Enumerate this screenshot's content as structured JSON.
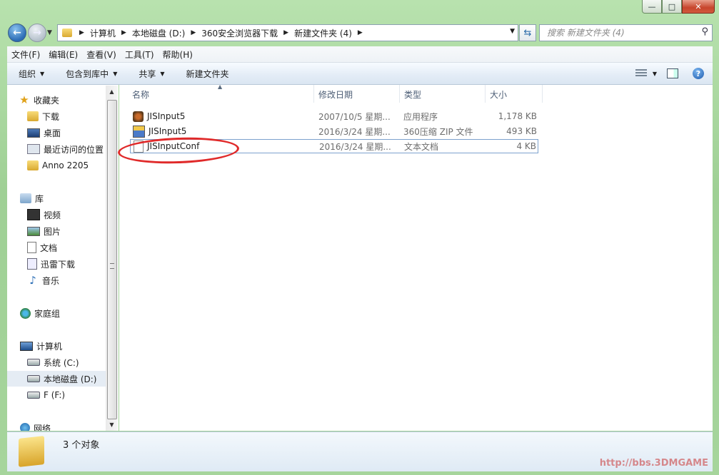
{
  "window": {
    "caption_buttons": [
      "—",
      "□",
      "✕"
    ]
  },
  "address": {
    "crumbs": [
      "计算机",
      "本地磁盘 (D:)",
      "360安全浏览器下载",
      "新建文件夹 (4)"
    ]
  },
  "search": {
    "placeholder": "搜索 新建文件夹 (4)"
  },
  "menu": [
    "文件(F)",
    "编辑(E)",
    "查看(V)",
    "工具(T)",
    "帮助(H)"
  ],
  "commands": [
    "组织",
    "包含到库中",
    "共享",
    "新建文件夹"
  ],
  "nav": {
    "favorites": {
      "label": "收藏夹",
      "items": [
        "下载",
        "桌面",
        "最近访问的位置",
        "Anno 2205"
      ]
    },
    "libraries": {
      "label": "库",
      "items": [
        "视频",
        "图片",
        "文档",
        "迅雷下载",
        "音乐"
      ]
    },
    "homegroup": "家庭组",
    "computer": {
      "label": "计算机",
      "items": [
        "系统 (C:)",
        "本地磁盘 (D:)",
        "F (F:)"
      ]
    },
    "network": "网络"
  },
  "columns": {
    "name": "名称",
    "date": "修改日期",
    "type": "类型",
    "size": "大小"
  },
  "files": [
    {
      "name": "JISInput5",
      "date": "2007/10/5 星期...",
      "type": "应用程序",
      "size": "1,178 KB",
      "icon": "app-icon"
    },
    {
      "name": "JISInput5",
      "date": "2016/3/24 星期...",
      "type": "360压缩 ZIP 文件",
      "size": "493 KB",
      "icon": "zip-icon"
    },
    {
      "name": "JISInputConf",
      "date": "2016/3/24 星期...",
      "type": "文本文档",
      "size": "4 KB",
      "icon": "text-file-icon"
    }
  ],
  "status": {
    "count": "3 个对象"
  },
  "watermark": "http://bbs.3DMGAME",
  "colors": {
    "frame": "#a9d3a0",
    "highlight_oval": "#e02a2a",
    "selection": "#7da2ce"
  }
}
